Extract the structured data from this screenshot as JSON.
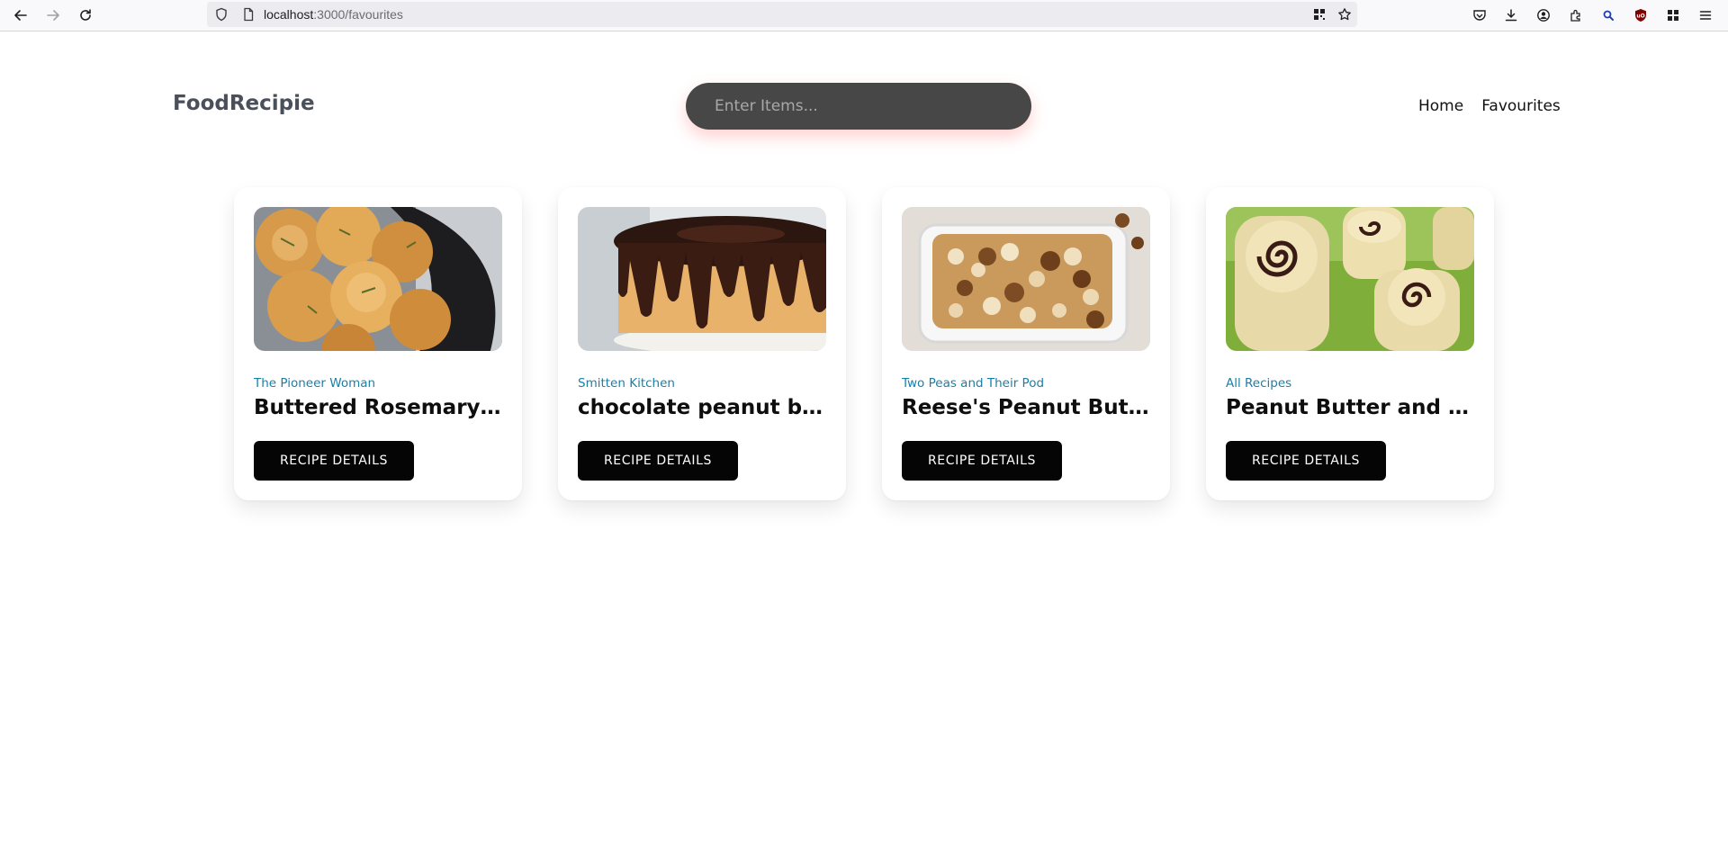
{
  "browser": {
    "url_host": "localhost",
    "url_path": ":3000/favourites",
    "icons": {
      "back": "back-arrow-icon",
      "forward": "forward-arrow-icon",
      "reload": "reload-icon",
      "shield": "shield-icon",
      "page": "page-icon",
      "qr": "qr-code-icon",
      "bookmark": "star-icon",
      "pocket": "pocket-icon",
      "downloads": "download-icon",
      "account": "account-icon",
      "extensions": "extensions-icon",
      "search_ext": "magnifier-icon",
      "ublock": "ublock-shield-icon",
      "apps": "apps-grid-icon",
      "menu": "hamburger-menu-icon"
    }
  },
  "site": {
    "logo": "FoodRecipie",
    "search": {
      "placeholder": "Enter Items...",
      "value": ""
    },
    "nav": [
      {
        "label": "Home"
      },
      {
        "label": "Favourites"
      }
    ]
  },
  "colors": {
    "publisher": "#1a7fa8",
    "button_bg": "#050505",
    "search_bg": "#474747",
    "search_glow": "#ff5a5a"
  },
  "cards": [
    {
      "publisher": "The Pioneer Woman",
      "title": "Buttered Rosemary R...",
      "button": "RECIPE DETAILS",
      "image": "rosemary-rolls-image"
    },
    {
      "publisher": "Smitten Kitchen",
      "title": "chocolate peanut butt...",
      "button": "RECIPE DETAILS",
      "image": "chocolate-peanut-butter-cake-image"
    },
    {
      "publisher": "Two Peas and Their Pod",
      "title": "Reese's Peanut Butter...",
      "button": "RECIPE DETAILS",
      "image": "peanut-butter-popcorn-image"
    },
    {
      "publisher": "All Recipes",
      "title": "Peanut Butter and Jel...",
      "button": "RECIPE DETAILS",
      "image": "pbj-roll-ups-image"
    }
  ]
}
